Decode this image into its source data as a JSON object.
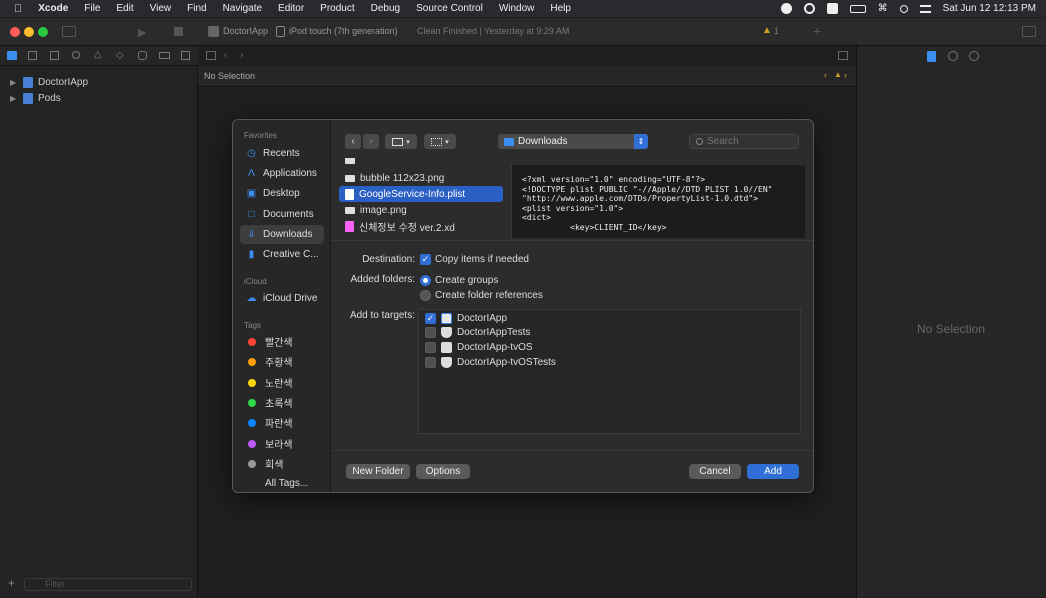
{
  "menubar": {
    "app_name": "Xcode",
    "items": [
      "File",
      "Edit",
      "View",
      "Find",
      "Navigate",
      "Editor",
      "Product",
      "Debug",
      "Source Control",
      "Window",
      "Help"
    ],
    "clock": "Sat Jun 12  12:13 PM"
  },
  "toolbar": {
    "scheme": "DoctorIApp",
    "device": "iPod touch (7th generation)",
    "status": "Clean Finished | Yesterday at 9:29 AM",
    "warning_count": "1"
  },
  "navigator": {
    "items": [
      {
        "label": "DoctorIApp"
      },
      {
        "label": "Pods"
      }
    ],
    "filter_placeholder": "Filter"
  },
  "editor": {
    "jumpbar_text": "No Selection"
  },
  "inspector": {
    "empty_text": "No Selection"
  },
  "dialog": {
    "sidebar": {
      "favorites_header": "Favorites",
      "favorites": [
        {
          "label": "Recents",
          "icon": "clock-icon"
        },
        {
          "label": "Applications",
          "icon": "applications-icon"
        },
        {
          "label": "Desktop",
          "icon": "desktop-icon"
        },
        {
          "label": "Documents",
          "icon": "document-icon"
        },
        {
          "label": "Downloads",
          "icon": "download-icon",
          "selected": true
        },
        {
          "label": "Creative C...",
          "icon": "file-icon"
        }
      ],
      "icloud_header": "iCloud",
      "icloud": [
        {
          "label": "iCloud Drive",
          "icon": "cloud-icon"
        }
      ],
      "tags_header": "Tags",
      "tags": [
        {
          "label": "빨간색",
          "color": "#ff453a"
        },
        {
          "label": "주황색",
          "color": "#ff9f0a"
        },
        {
          "label": "노란색",
          "color": "#ffd60a"
        },
        {
          "label": "초록색",
          "color": "#32d74b"
        },
        {
          "label": "파란색",
          "color": "#0a84ff"
        },
        {
          "label": "보라색",
          "color": "#bf5af2"
        },
        {
          "label": "회색",
          "color": "#98989d"
        },
        {
          "label": "All Tags..."
        }
      ]
    },
    "location": "Downloads",
    "search_placeholder": "Search",
    "files": [
      {
        "name": "bubble 112x23.png"
      },
      {
        "name": "GoogleService-Info.plist",
        "selected": true
      },
      {
        "name": "image.png"
      },
      {
        "name": "신체정보 수정 ver.2.xd"
      }
    ],
    "preview_text": "<?xml version=\"1.0\" encoding=\"UTF-8\"?>\n<!DOCTYPE plist PUBLIC \"-//Apple//DTD PLIST 1.0//EN\"\n\"http://www.apple.com/DTDs/PropertyList-1.0.dtd\">\n<plist version=\"1.0\">\n<dict>\n          <key>CLIENT_ID</key>",
    "options": {
      "destination_label": "Destination:",
      "destination_option": "Copy items if needed",
      "added_folders_label": "Added folders:",
      "create_groups": "Create groups",
      "create_folder_refs": "Create folder references",
      "add_to_targets_label": "Add to targets:"
    },
    "targets": [
      {
        "label": "DoctorIApp",
        "checked": true
      },
      {
        "label": "DoctorIAppTests",
        "checked": false
      },
      {
        "label": "DoctorIApp-tvOS",
        "checked": false
      },
      {
        "label": "DoctorIApp-tvOSTests",
        "checked": false
      }
    ],
    "buttons": {
      "new_folder": "New Folder",
      "options": "Options",
      "cancel": "Cancel",
      "add": "Add"
    }
  }
}
